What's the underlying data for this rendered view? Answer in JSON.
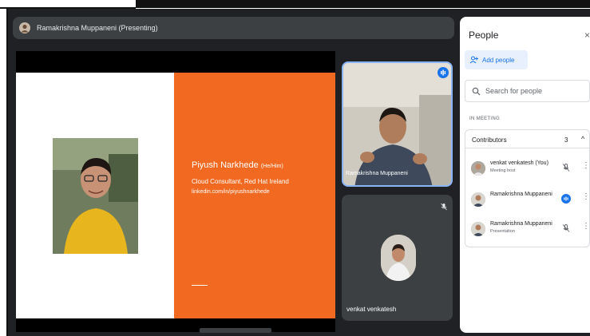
{
  "presenting_bar": {
    "label": "Ramakrishna Muppaneni (Presenting)"
  },
  "slide": {
    "name": "Piyush Narkhede",
    "name_tag": "(He/Him)",
    "role": "Cloud Consultant, Red Hat Ireland",
    "link": "linkedin.com/in/piyushnarkhede"
  },
  "tiles": [
    {
      "label": "Ramakrishna Muppaneni"
    },
    {
      "label": "venkat venkatesh"
    }
  ],
  "panel": {
    "title": "People",
    "close": "×",
    "add_people": "Add people",
    "search_placeholder": "Search for people",
    "section": "IN MEETING",
    "group": {
      "label": "Contributors",
      "count": "3"
    },
    "people": [
      {
        "name": "venkat venkatesh (You)",
        "subtitle": "Meeting host"
      },
      {
        "name": "Ramakrishna Muppaneni",
        "subtitle": ""
      },
      {
        "name": "Ramakrishna Muppaneni",
        "subtitle": "Presentation"
      }
    ]
  },
  "colors": {
    "accent": "#1a73e8",
    "slide_orange": "#f26a21",
    "meet_bg": "#202124"
  }
}
